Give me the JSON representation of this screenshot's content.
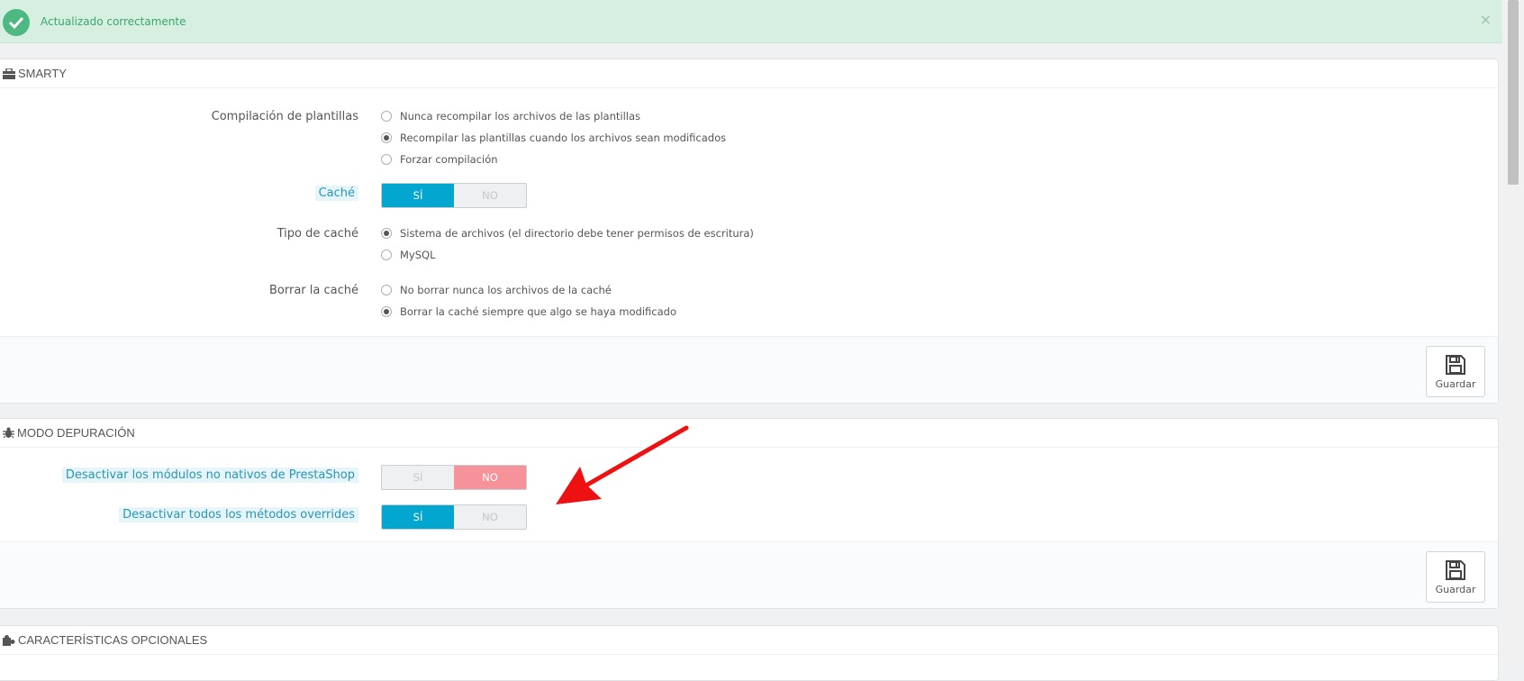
{
  "alert": {
    "message": "Actualizado correctamente",
    "close": "×"
  },
  "smarty": {
    "title": "SMARTY",
    "template_compilation": {
      "label": "Compilación de plantillas",
      "options": [
        "Nunca recompilar los archivos de las plantillas",
        "Recompilar las plantillas cuando los archivos sean modificados",
        "Forzar compilación"
      ],
      "selected_index": 1
    },
    "cache": {
      "label": "Caché",
      "yes": "SÍ",
      "no": "NO",
      "value": "yes"
    },
    "cache_type": {
      "label": "Tipo de caché",
      "options": [
        "Sistema de archivos (el directorio debe tener permisos de escritura)",
        "MySQL"
      ],
      "selected_index": 0
    },
    "clear_cache": {
      "label": "Borrar la caché",
      "options": [
        "No borrar nunca los archivos de la caché",
        "Borrar la caché siempre que algo se haya modificado"
      ],
      "selected_index": 1
    },
    "save_label": "Guardar"
  },
  "debug": {
    "title": "MODO DEPURACIÓN",
    "disable_non_native": {
      "label": "Desactivar los módulos no nativos de PrestaShop",
      "yes": "SÍ",
      "no": "NO",
      "value": "no"
    },
    "disable_overrides": {
      "label": "Desactivar todos los métodos overrides",
      "yes": "SÍ",
      "no": "NO",
      "value": "yes"
    },
    "save_label": "Guardar"
  },
  "optional": {
    "title": "CARACTERÍSTICAS OPCIONALES"
  },
  "colors": {
    "accent": "#03a6cf",
    "no_active": "#f6929a",
    "success": "#4db882",
    "annotation_arrow": "#ee1111"
  }
}
